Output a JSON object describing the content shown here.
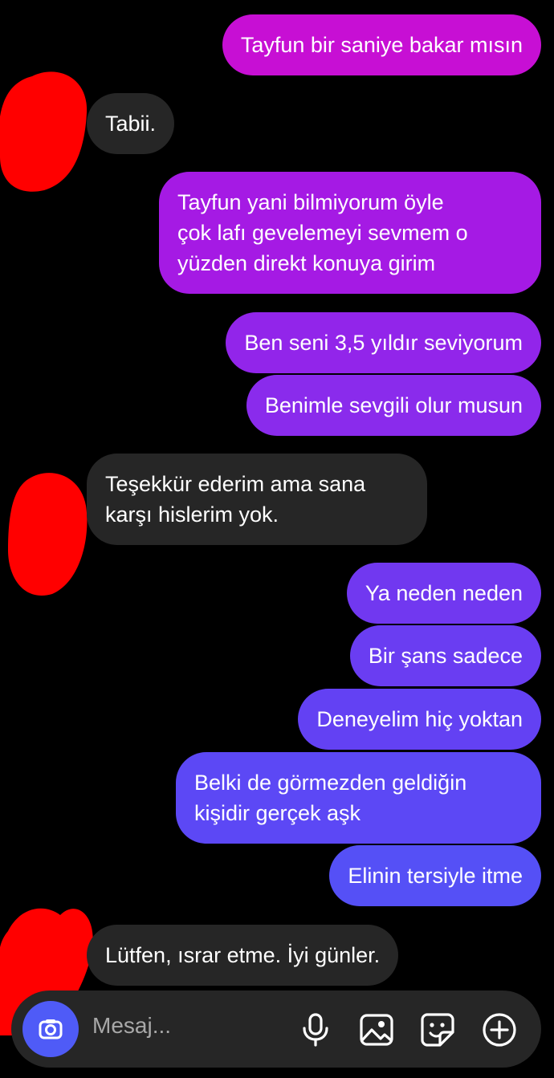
{
  "messages": [
    {
      "side": "out",
      "text": "Tayfun bir saniye bakar mısın",
      "color": "#c70fd4"
    },
    {
      "side": "in",
      "text": "Tabii."
    },
    {
      "side": "out",
      "text": "Tayfun yani bilmiyorum öyle\nçok lafı gevelemeyi sevmem o\nyüzden direkt konuya girim",
      "color": "#a51ae4"
    },
    {
      "side": "out",
      "text": "Ben seni 3,5 yıldır seviyorum",
      "color": "#9225ea"
    },
    {
      "side": "out",
      "text": "Benimle sevgili olur musun",
      "color": "#8a2bec"
    },
    {
      "side": "in",
      "text": "Teşekkür ederim ama sana\nkarşı hislerim yok."
    },
    {
      "side": "out",
      "text": "Ya neden neden",
      "color": "#7138f0"
    },
    {
      "side": "out",
      "text": "Bir şans sadece",
      "color": "#6a3df2"
    },
    {
      "side": "out",
      "text": "Deneyelim hiç yoktan",
      "color": "#6341f3"
    },
    {
      "side": "out",
      "text": "Belki de görmezden geldiğin\nkişidir gerçek aşk",
      "color": "#5c48f5"
    },
    {
      "side": "out",
      "text": "Elinin tersiyle itme",
      "color": "#5550f6"
    },
    {
      "side": "in",
      "text": "Lütfen, ısrar etme. İyi günler."
    }
  ],
  "composer": {
    "placeholder": "Mesaj...",
    "accent": "#4f5bf7",
    "icons": [
      "camera-icon",
      "microphone-icon",
      "image-icon",
      "sticker-icon",
      "plus-icon"
    ]
  },
  "redaction_color": "#ff0000"
}
